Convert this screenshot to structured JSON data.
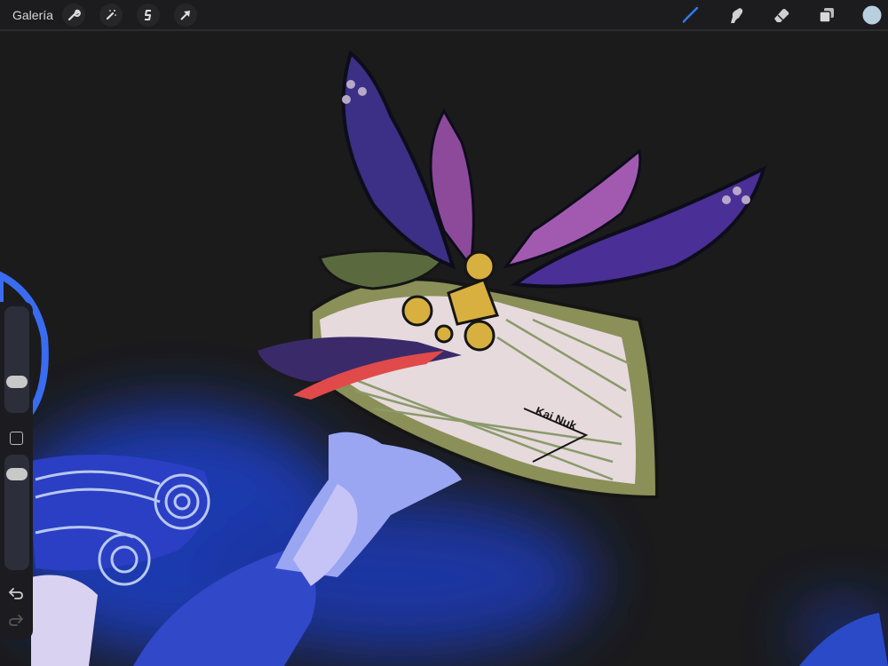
{
  "topbar": {
    "gallery_label": "Galería",
    "left_tools": [
      {
        "name": "actions",
        "icon": "wrench-icon"
      },
      {
        "name": "adjustments",
        "icon": "magic-wand-icon"
      },
      {
        "name": "selection",
        "icon": "selection-s-icon"
      },
      {
        "name": "transform",
        "icon": "arrow-cursor-icon"
      }
    ],
    "right_tools": [
      {
        "name": "brush",
        "icon": "brush-icon",
        "active": true
      },
      {
        "name": "smudge",
        "icon": "smudge-finger-icon"
      },
      {
        "name": "eraser",
        "icon": "eraser-icon"
      },
      {
        "name": "layers",
        "icon": "layers-icon"
      },
      {
        "name": "color",
        "icon": "color-swatch-icon"
      }
    ],
    "accent_color": "#2f7cf6",
    "current_color": "#b9cfe0"
  },
  "sidebar": {
    "brush_size_fraction": 0.25,
    "opacity_fraction": 0.9,
    "undo_icon": "undo-icon",
    "redo_icon": "redo-icon"
  },
  "artwork": {
    "signature": "Kai Nuk"
  }
}
